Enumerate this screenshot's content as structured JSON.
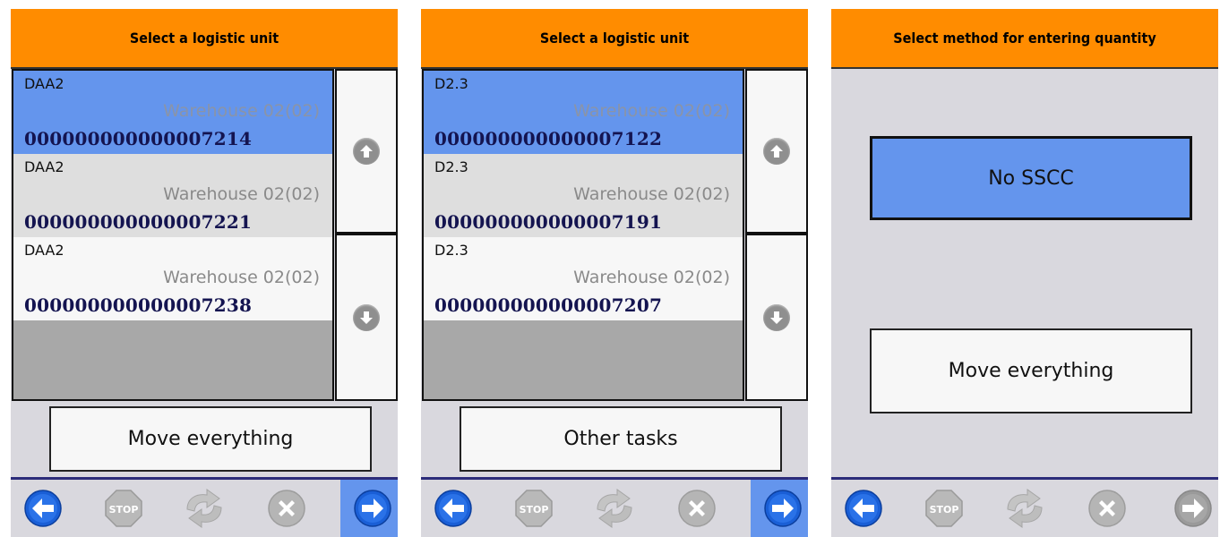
{
  "panels": [
    {
      "title": "Select a logistic unit",
      "items": [
        {
          "code": "DAA2",
          "warehouse": "Warehouse 02(02)",
          "sscc": "000000000000007214"
        },
        {
          "code": "DAA2",
          "warehouse": "Warehouse 02(02)",
          "sscc": "000000000000007221"
        },
        {
          "code": "DAA2",
          "warehouse": "Warehouse 02(02)",
          "sscc": "000000000000007238"
        }
      ],
      "button_label": "Move everything"
    },
    {
      "title": "Select a logistic unit",
      "items": [
        {
          "code": "D2.3",
          "warehouse": "Warehouse 02(02)",
          "sscc": "000000000000007122"
        },
        {
          "code": "D2.3",
          "warehouse": "Warehouse 02(02)",
          "sscc": "000000000000007191"
        },
        {
          "code": "D2.3",
          "warehouse": "Warehouse 02(02)",
          "sscc": "000000000000007207"
        }
      ],
      "button_label": "Other tasks"
    },
    {
      "title": "Select method for entering quantity",
      "option_selected": "No SSCC",
      "option_other": "Move everything"
    }
  ],
  "nav_icons": [
    "back-arrow-icon",
    "stop-icon",
    "refresh-icon",
    "cancel-icon",
    "forward-arrow-icon"
  ],
  "nav_stop_label": "STOP",
  "colors": {
    "header": "#ff8c00",
    "selected": "#6495ed",
    "sscc_text": "#141450",
    "panel_bg": "#d9d8de"
  }
}
